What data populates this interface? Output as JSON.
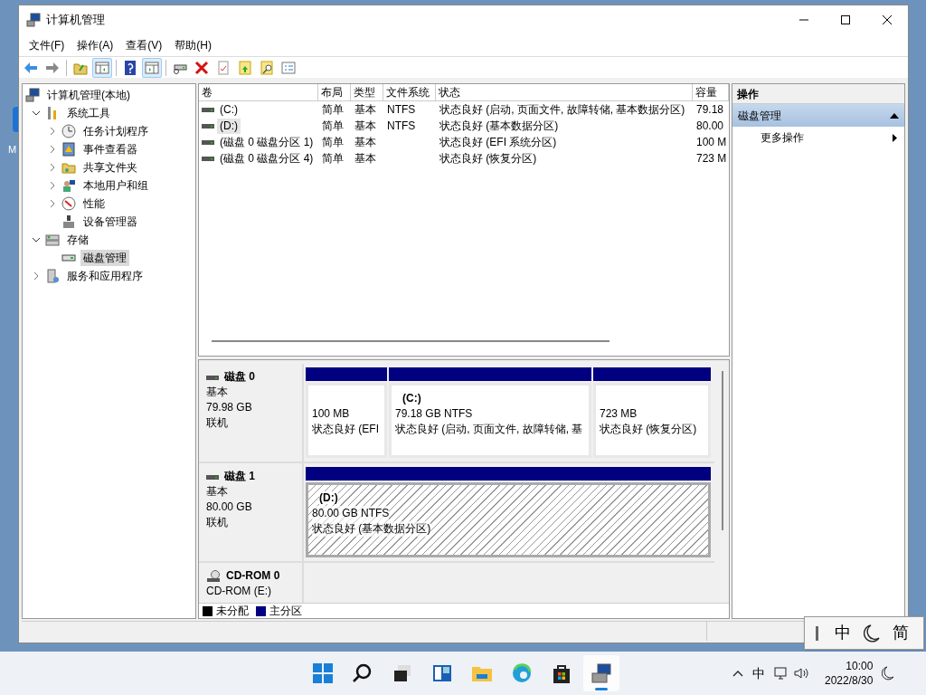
{
  "desktop": {
    "icon_label": "M"
  },
  "window": {
    "title": "计算机管理"
  },
  "menu": [
    "文件(F)",
    "操作(A)",
    "查看(V)",
    "帮助(H)"
  ],
  "toolbar": [
    {
      "pressed": false
    },
    {
      "pressed": false
    },
    {
      "pressed": false
    },
    {
      "pressed": true
    },
    {
      "pressed": false
    },
    {
      "pressed": true
    },
    {
      "pressed": false
    },
    {
      "pressed": false
    },
    {
      "pressed": false
    },
    {
      "pressed": false
    },
    {
      "pressed": false
    },
    {
      "pressed": false
    }
  ],
  "tree": [
    {
      "label": "计算机管理(本地)",
      "kind": "root",
      "selected": false,
      "children": [
        {
          "label": "系统工具",
          "kind": "expanded",
          "selected": false,
          "children": [
            {
              "label": "任务计划程序",
              "kind": "collapsed",
              "selected": false
            },
            {
              "label": "事件查看器",
              "kind": "collapsed",
              "selected": false
            },
            {
              "label": "共享文件夹",
              "kind": "collapsed",
              "selected": false
            },
            {
              "label": "本地用户和组",
              "kind": "collapsed",
              "selected": false
            },
            {
              "label": "性能",
              "kind": "collapsed",
              "selected": false
            },
            {
              "label": "设备管理器",
              "kind": "leaf",
              "selected": false
            }
          ]
        },
        {
          "label": "存储",
          "kind": "expanded",
          "selected": false,
          "children": [
            {
              "label": "磁盘管理",
              "kind": "leaf",
              "selected": true
            }
          ]
        },
        {
          "label": "服务和应用程序",
          "kind": "collapsed",
          "selected": false
        }
      ]
    }
  ],
  "volumes": {
    "columns": [
      "卷",
      "布局",
      "类型",
      "文件系统",
      "状态",
      "容量"
    ],
    "rows": [
      {
        "name": "(C:)",
        "layout": "简单",
        "type": "基本",
        "fs": "NTFS",
        "status": "状态良好 (启动, 页面文件, 故障转储, 基本数据分区)",
        "capacity": "79.18",
        "selected": false
      },
      {
        "name": "(D:)",
        "layout": "简单",
        "type": "基本",
        "fs": "NTFS",
        "status": "状态良好 (基本数据分区)",
        "capacity": "80.00",
        "selected": true
      },
      {
        "name": "(磁盘 0 磁盘分区 1)",
        "layout": "简单",
        "type": "基本",
        "status": "状态良好 (EFI 系统分区)",
        "capacity": "100 M",
        "selected": false
      },
      {
        "name": "(磁盘 0 磁盘分区 4)",
        "layout": "简单",
        "type": "基本",
        "status": "状态良好 (恢复分区)",
        "capacity": "723 M",
        "selected": false
      }
    ]
  },
  "disks": [
    {
      "name": "磁盘 0",
      "kind": "disk",
      "lines": [
        "基本",
        "79.98 GB",
        "联机"
      ],
      "partitions": [
        {
          "size": "100 MB",
          "status": "状态良好 (EFI",
          "color": "#000080",
          "selected": false
        },
        {
          "label": "(C:)",
          "size": "79.18 GB NTFS",
          "status": "状态良好 (启动, 页面文件, 故障转储, 基",
          "color": "#000080",
          "selected": false
        },
        {
          "size": "723 MB",
          "status": "状态良好 (恢复分区)",
          "color": "#000080",
          "selected": false
        }
      ]
    },
    {
      "name": "磁盘 1",
      "kind": "disk",
      "lines": [
        "基本",
        "80.00 GB",
        "联机"
      ],
      "partitions": [
        {
          "label": "(D:)",
          "size": "80.00 GB NTFS",
          "status": "状态良好 (基本数据分区)",
          "color": "#000080",
          "selected": true
        }
      ]
    },
    {
      "name": "CD-ROM 0",
      "kind": "cdrom",
      "lines": [
        "CD-ROM (E:)"
      ]
    }
  ],
  "legend": [
    {
      "label": "未分配",
      "color": "#000000"
    },
    {
      "label": "主分区",
      "color": "#000080"
    }
  ],
  "actions": {
    "header": "操作",
    "section": "磁盘管理",
    "items": [
      "更多操作"
    ]
  },
  "ime": {
    "mode": "中",
    "width": "简"
  },
  "taskbar": {
    "apps": [
      {
        "running": false
      },
      {
        "running": false
      },
      {
        "running": false
      },
      {
        "running": false
      },
      {
        "running": false
      },
      {
        "running": false
      },
      {
        "running": false
      },
      {
        "running": true
      }
    ],
    "ime": "中",
    "time": "10:00",
    "date": "2022/8/30"
  }
}
